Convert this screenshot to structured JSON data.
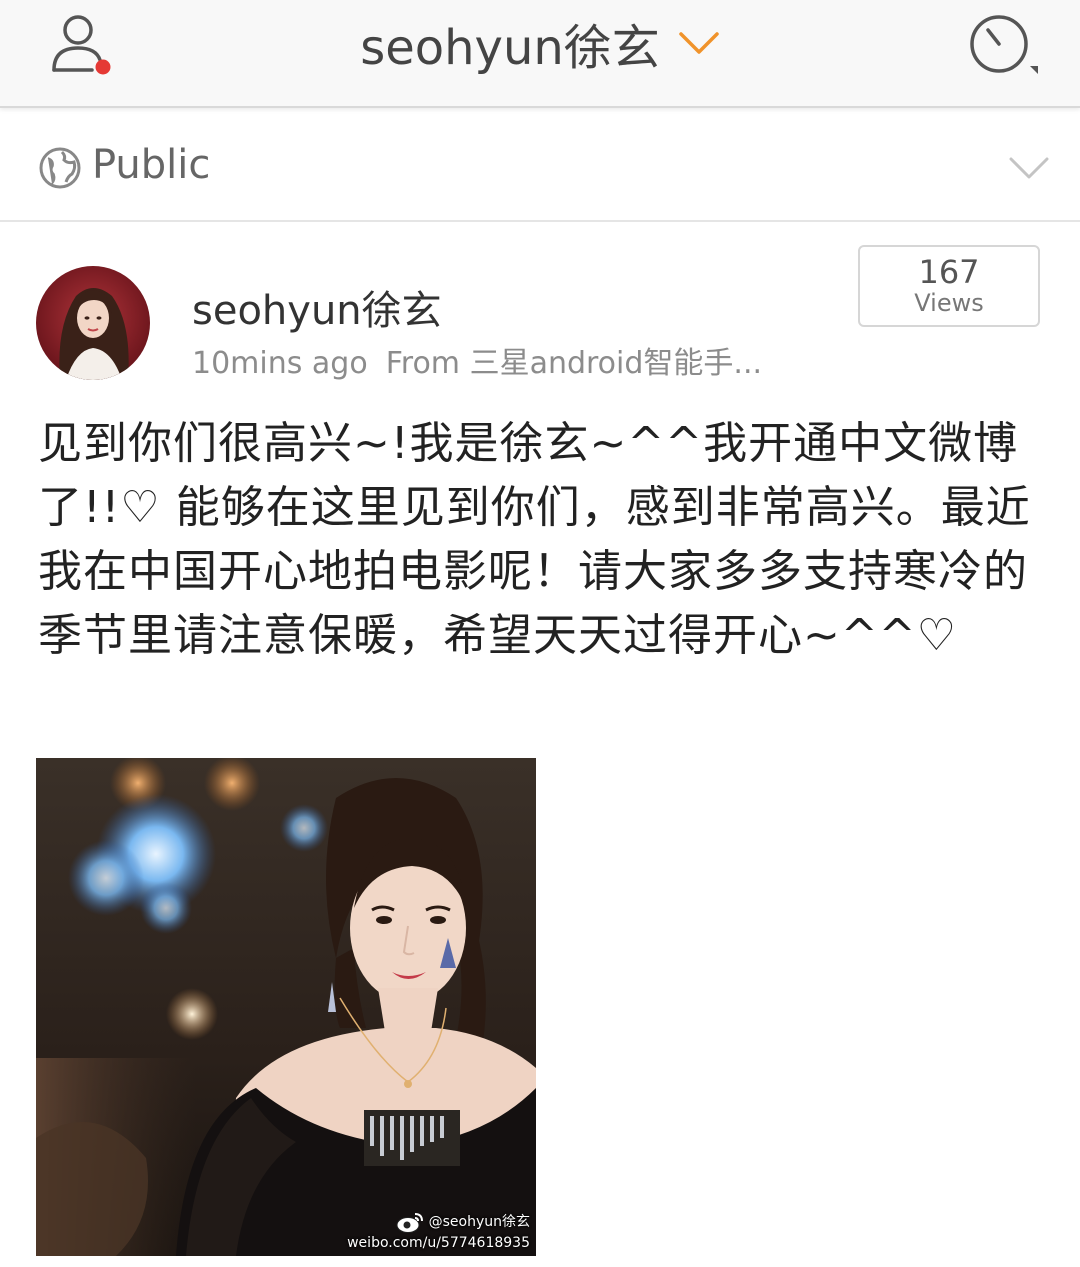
{
  "header": {
    "title": "seohyun徐玄",
    "profile_icon": "user-icon",
    "notification_dot_color": "#e53935",
    "title_chevron_color": "#f0932b",
    "history_icon": "clock-icon"
  },
  "visibility": {
    "label": "Public",
    "icon": "globe-icon"
  },
  "post": {
    "author": "seohyun徐玄",
    "time": "10mins ago",
    "source": "From 三星android智能手...",
    "views_count": "167",
    "views_label": "Views",
    "text": "见到你们很高兴~!我是徐玄~^^我开通中文微博了!!♡ 能够在这里见到你们，感到非常高兴。最近我在中国开心地拍电影呢！请大家多多支持寒冷的季节里请注意保暖，希望天天过得开心~^^♡",
    "image": {
      "watermark_handle": "@seohyun徐玄",
      "watermark_url": "weibo.com/u/5774618935"
    }
  }
}
